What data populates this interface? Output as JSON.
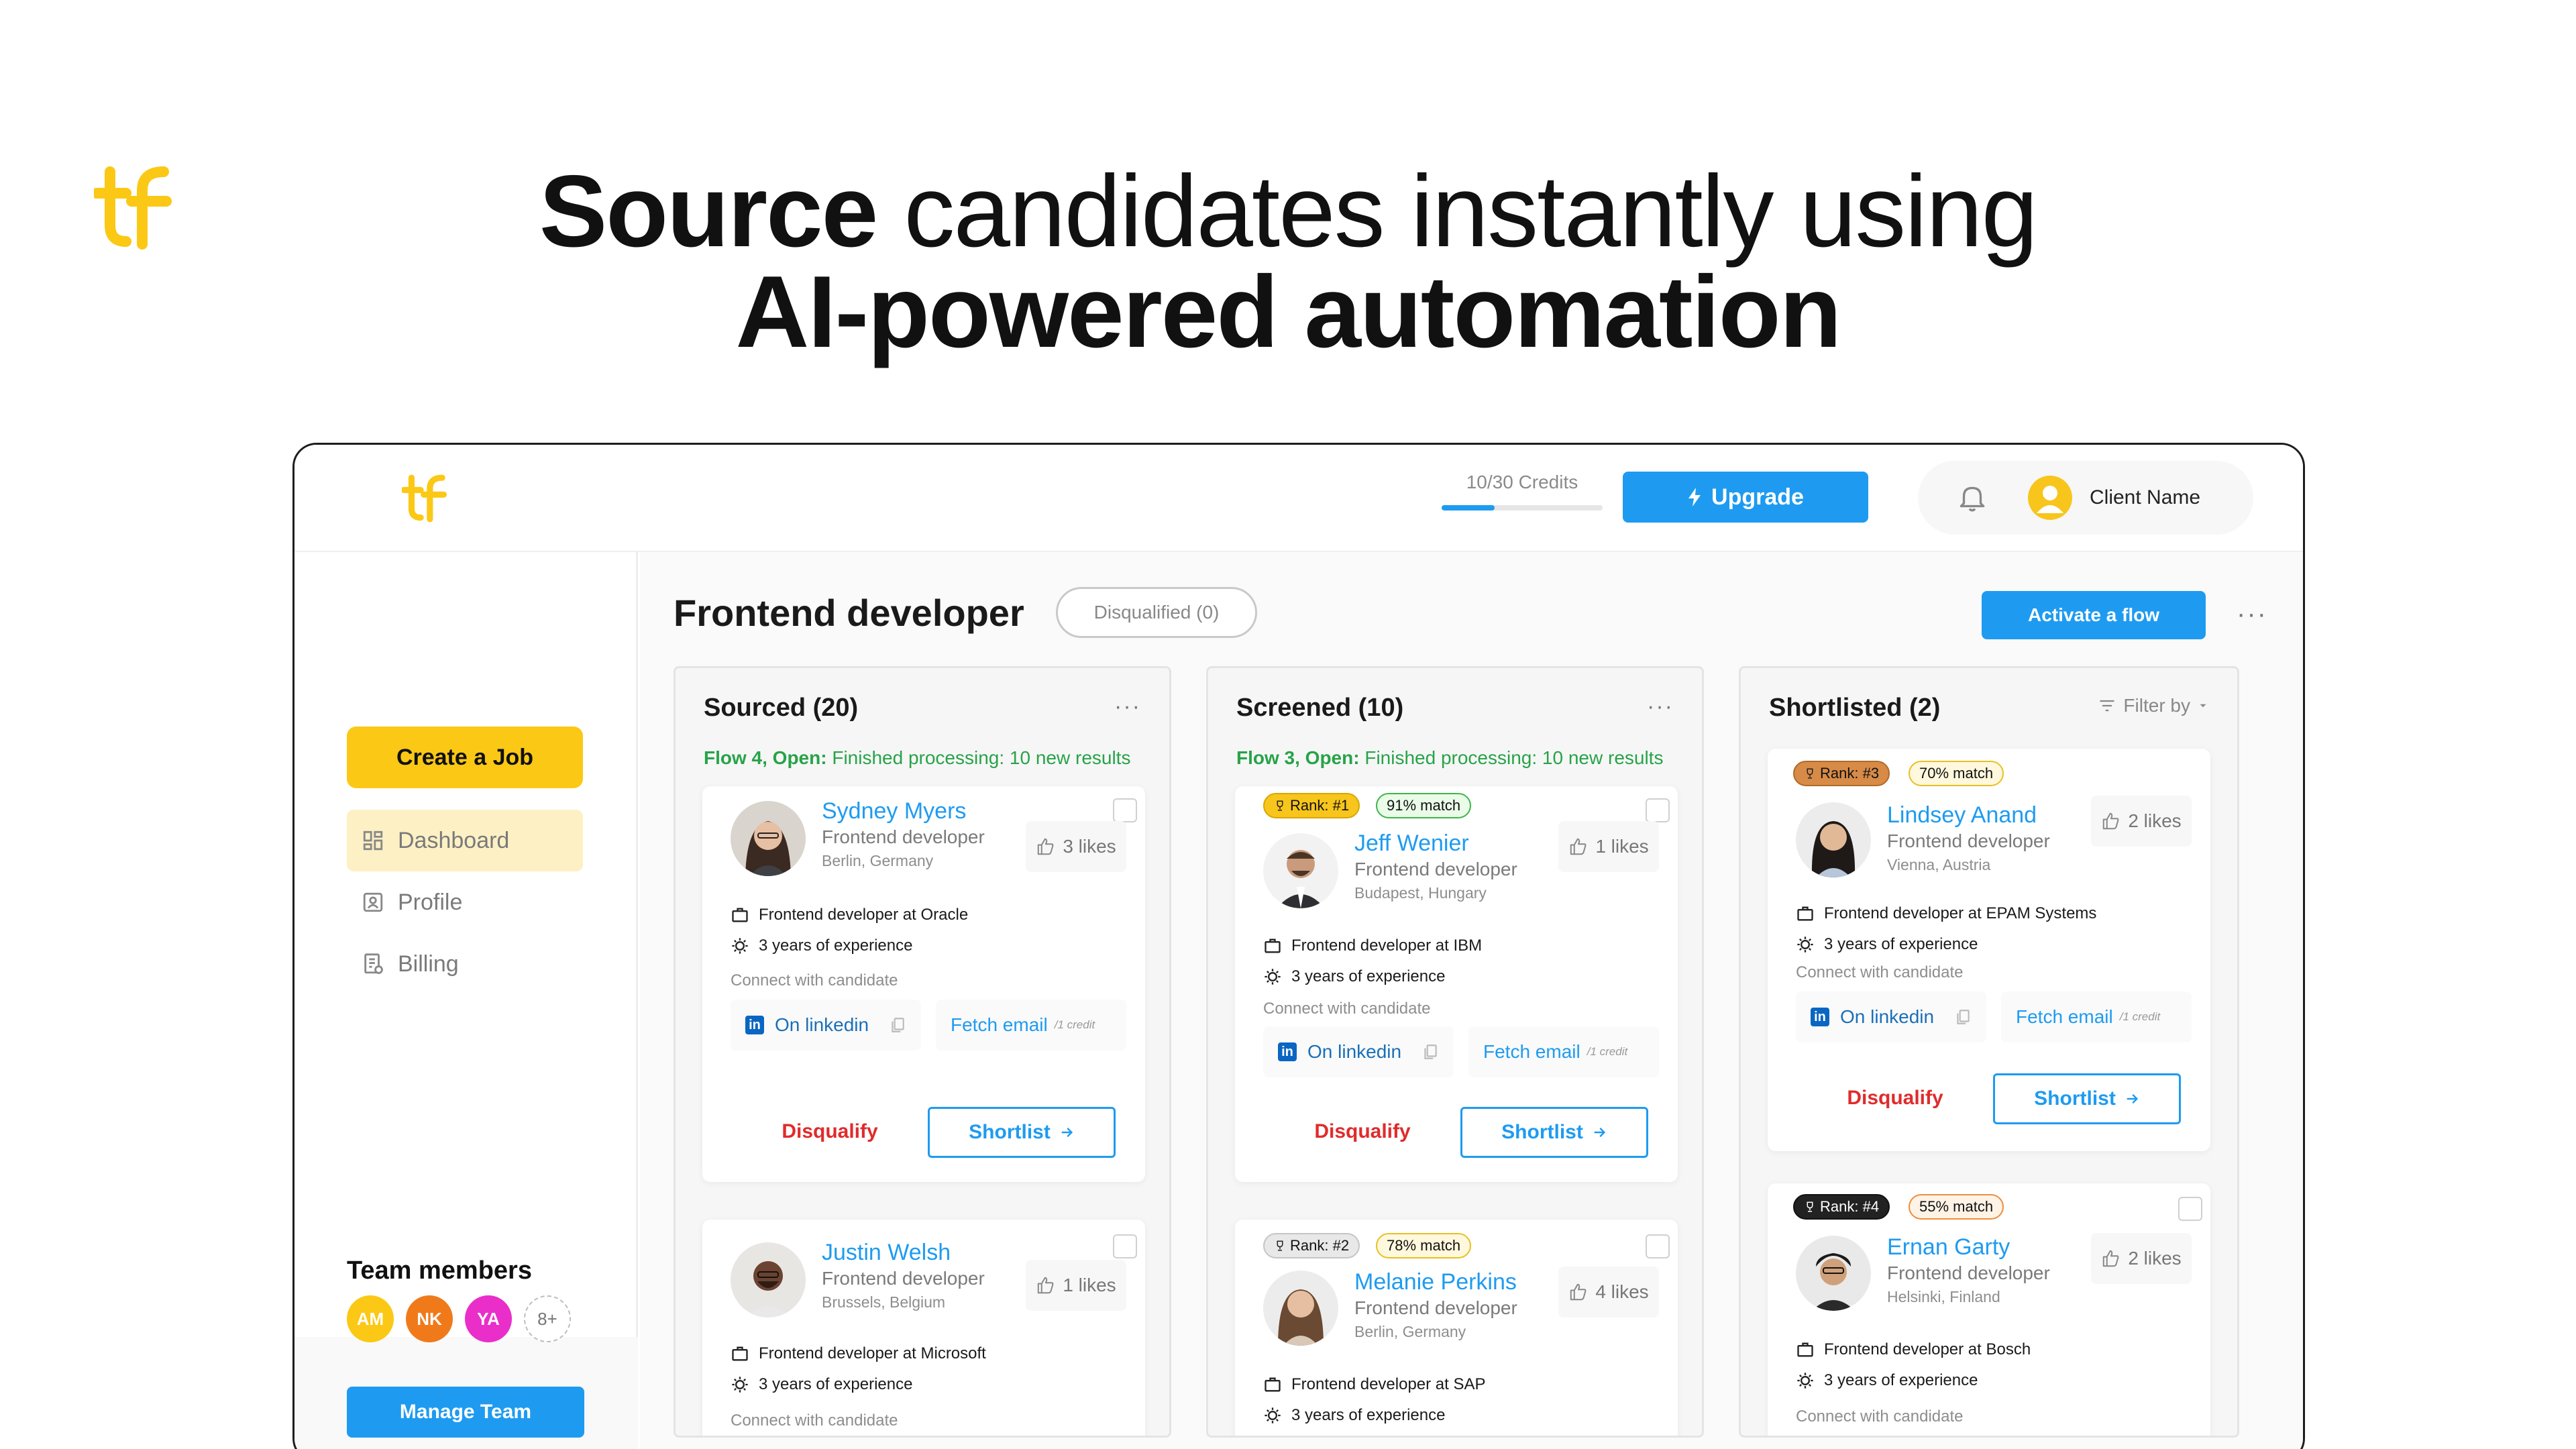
{
  "hero": {
    "line1_bold": "Source",
    "line1_rest": " candidates instantly using",
    "line2": "AI-powered automation"
  },
  "brand": {
    "logo_icon": "tf-logo-icon",
    "accent_color": "#fbc815",
    "primary_color": "#1e9bf0"
  },
  "topbar": {
    "credits_label": "10/30 Credits",
    "credits_progress": 0.33,
    "upgrade_label": "Upgrade",
    "client_name": "Client Name"
  },
  "sidebar": {
    "create_job_label": "Create a Job",
    "nav": [
      {
        "label": "Dashboard",
        "icon": "dashboard-icon",
        "active": true
      },
      {
        "label": "Profile",
        "icon": "profile-icon",
        "active": false
      },
      {
        "label": "Billing",
        "icon": "billing-icon",
        "active": false
      }
    ],
    "team_title": "Team members",
    "team": [
      {
        "initials": "AM",
        "color": "#fbc815"
      },
      {
        "initials": "NK",
        "color": "#f07a1a"
      },
      {
        "initials": "YA",
        "color": "#ea2ec9"
      },
      {
        "initials": "8+",
        "color": "#ffffff"
      }
    ],
    "manage_team_label": "Manage Team"
  },
  "main": {
    "job_title": "Frontend developer",
    "disqualified_label": "Disqualified (0)",
    "activate_flow_label": "Activate a flow",
    "more_label": "···"
  },
  "columns": [
    {
      "title": "Sourced (20)",
      "more": "···",
      "status_bold": "Flow 4, Open:",
      "status_text": " Finished processing: 10 new results",
      "cards": [
        {
          "name": "Sydney Myers",
          "role": "Frontend developer",
          "location": "Berlin, Germany",
          "likes": "3 likes",
          "job": "Frontend developer at Oracle",
          "experience": "3 years of experience",
          "connect": "Connect with candidate",
          "linkedin": "On linkedin",
          "fetch": "Fetch email",
          "fetch_cost": "/1 credit",
          "disqualify": "Disqualify",
          "shortlist": "Shortlist"
        },
        {
          "name": "Justin Welsh",
          "role": "Frontend developer",
          "location": "Brussels, Belgium",
          "likes": "1 likes",
          "job": "Frontend developer at Microsoft",
          "experience": "3 years of experience",
          "connect": "Connect with candidate"
        }
      ]
    },
    {
      "title": "Screened (10)",
      "more": "···",
      "status_bold": "Flow 3, Open:",
      "status_text": " Finished processing: 10 new results",
      "cards": [
        {
          "rank": "Rank: #1",
          "match": "91% match",
          "name": "Jeff Wenier",
          "role": "Frontend developer",
          "location": "Budapest, Hungary",
          "likes": "1 likes",
          "job": "Frontend developer at IBM",
          "experience": "3 years of experience",
          "connect": "Connect with candidate",
          "linkedin": "On linkedin",
          "fetch": "Fetch email",
          "fetch_cost": "/1 credit",
          "disqualify": "Disqualify",
          "shortlist": "Shortlist"
        },
        {
          "rank": "Rank: #2",
          "match": "78% match",
          "name": "Melanie Perkins",
          "role": "Frontend developer",
          "location": "Berlin, Germany",
          "likes": "4 likes",
          "job": "Frontend developer at SAP",
          "experience": "3 years of experience"
        }
      ]
    },
    {
      "title": "Shortlisted (2)",
      "filter": "Filter by",
      "cards": [
        {
          "rank": "Rank: #3",
          "match": "70% match",
          "name": "Lindsey Anand",
          "role": "Frontend developer",
          "location": "Vienna, Austria",
          "likes": "2 likes",
          "job": "Frontend developer at EPAM Systems",
          "experience": "3 years of experience",
          "connect": "Connect with candidate",
          "linkedin": "On linkedin",
          "fetch": "Fetch email",
          "fetch_cost": "/1 credit",
          "disqualify": "Disqualify",
          "shortlist": "Shortlist"
        },
        {
          "rank": "Rank: #4",
          "match": "55% match",
          "name": "Ernan Garty",
          "role": "Frontend developer",
          "location": "Helsinki, Finland",
          "likes": "2 likes",
          "job": "Frontend developer at Bosch",
          "experience": "3 years of experience",
          "connect": "Connect with candidate"
        }
      ]
    }
  ]
}
